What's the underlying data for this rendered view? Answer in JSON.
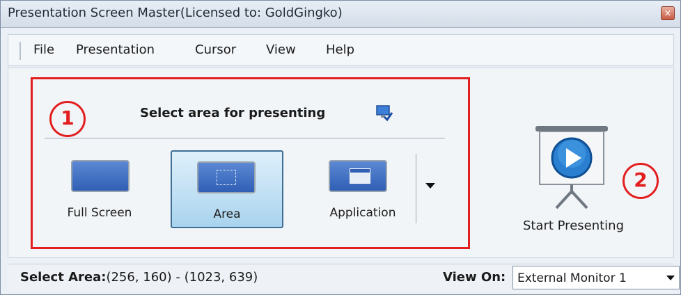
{
  "window": {
    "title": "Presentation Screen Master(Licensed to: GoldGingko)",
    "close_glyph": "×"
  },
  "menu": {
    "items": [
      {
        "label": "File"
      },
      {
        "label": "Presentation"
      },
      {
        "label": "Cursor"
      },
      {
        "label": "View"
      },
      {
        "label": "Help"
      }
    ]
  },
  "area_group": {
    "badge": "1",
    "title": "Select area for presenting",
    "settings_icon": "monitor-check-icon",
    "modes": [
      {
        "label": "Full Screen",
        "icon": "fullscreen-icon",
        "selected": false
      },
      {
        "label": "Area",
        "icon": "area-select-icon",
        "selected": true
      },
      {
        "label": "Application",
        "icon": "application-window-icon",
        "selected": false
      }
    ],
    "dropdown_icon": "chevron-down-icon"
  },
  "start": {
    "badge": "2",
    "label": "Start Presenting",
    "icon": "projector-play-icon"
  },
  "status": {
    "select_area_key": "Select Area:",
    "select_area_value": "(256, 160) - (1023, 639)",
    "view_on_label": "View On:",
    "view_on_value": "External Monitor 1"
  },
  "colors": {
    "annotation_red": "#e31e1e",
    "selected_blue": "#a9d3ee",
    "play_blue": "#2b7fd0"
  }
}
